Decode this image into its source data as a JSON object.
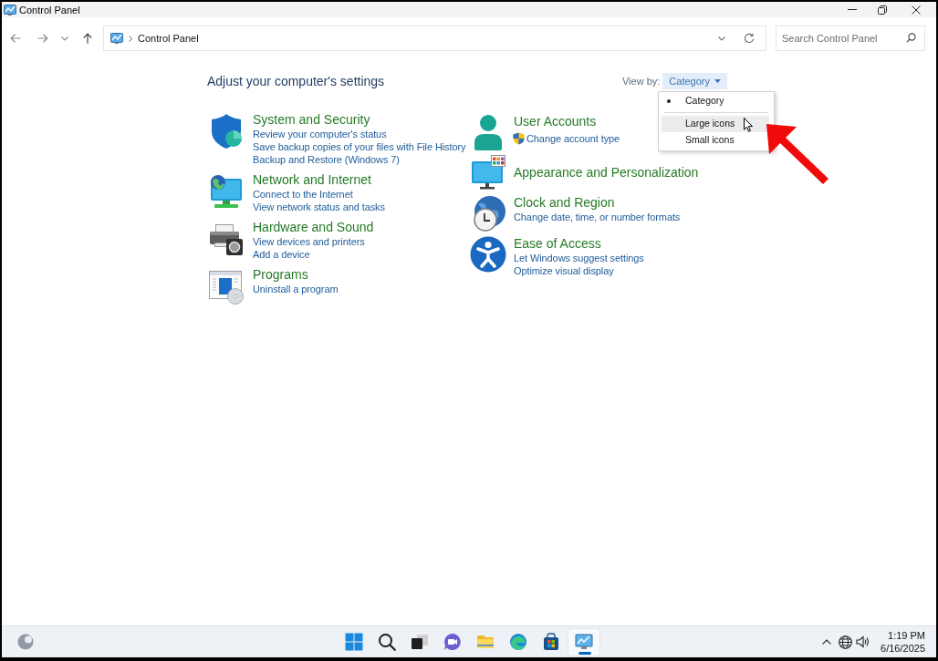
{
  "window": {
    "title": "Control Panel"
  },
  "address_bar": {
    "path": [
      "Control Panel"
    ]
  },
  "search": {
    "placeholder": "Search Control Panel"
  },
  "heading": "Adjust your computer's settings",
  "view_by": {
    "label": "View by:",
    "value": "Category",
    "expanded": true,
    "options": [
      {
        "label": "Category",
        "selected": true,
        "highlighted": false
      },
      {
        "label": "Large icons",
        "selected": false,
        "highlighted": true
      },
      {
        "label": "Small icons",
        "selected": false,
        "highlighted": false
      }
    ]
  },
  "category_columns": [
    {
      "categories": [
        {
          "title": "System and Security",
          "links": [
            {
              "text": "Review your computer's status",
              "kind": "plain"
            },
            {
              "text": "Save backup copies of your files with File History",
              "kind": "plain"
            },
            {
              "text": "Backup and Restore (Windows 7)",
              "kind": "plain"
            }
          ]
        },
        {
          "title": "Network and Internet",
          "links": [
            {
              "text": "Connect to the Internet",
              "kind": "plain"
            },
            {
              "text": "View network status and tasks",
              "kind": "plain"
            }
          ]
        },
        {
          "title": "Hardware and Sound",
          "links": [
            {
              "text": "View devices and printers",
              "kind": "plain"
            },
            {
              "text": "Add a device",
              "kind": "plain"
            }
          ]
        },
        {
          "title": "Programs",
          "links": [
            {
              "text": "Uninstall a program",
              "kind": "plain"
            }
          ]
        }
      ]
    },
    {
      "categories": [
        {
          "title": "User Accounts",
          "links": [
            {
              "text": "Change account type",
              "kind": "admin"
            }
          ]
        },
        {
          "title": "Appearance and Personalization"
        },
        {
          "title": "Clock and Region",
          "links": [
            {
              "text": "Change date, time, or number formats",
              "kind": "plain"
            }
          ]
        },
        {
          "title": "Ease of Access",
          "links": [
            {
              "text": "Let Windows suggest settings",
              "kind": "plain"
            },
            {
              "text": "Optimize visual display",
              "kind": "plain"
            }
          ]
        }
      ]
    }
  ],
  "taskbar": {
    "apps": [
      {
        "selected": false
      },
      {
        "selected": false
      },
      {
        "selected": false
      },
      {
        "selected": false
      },
      {
        "selected": false
      },
      {
        "selected": false
      },
      {
        "selected": false
      },
      {
        "selected": true
      }
    ],
    "time": "1:19 PM",
    "date": "6/16/2025"
  }
}
